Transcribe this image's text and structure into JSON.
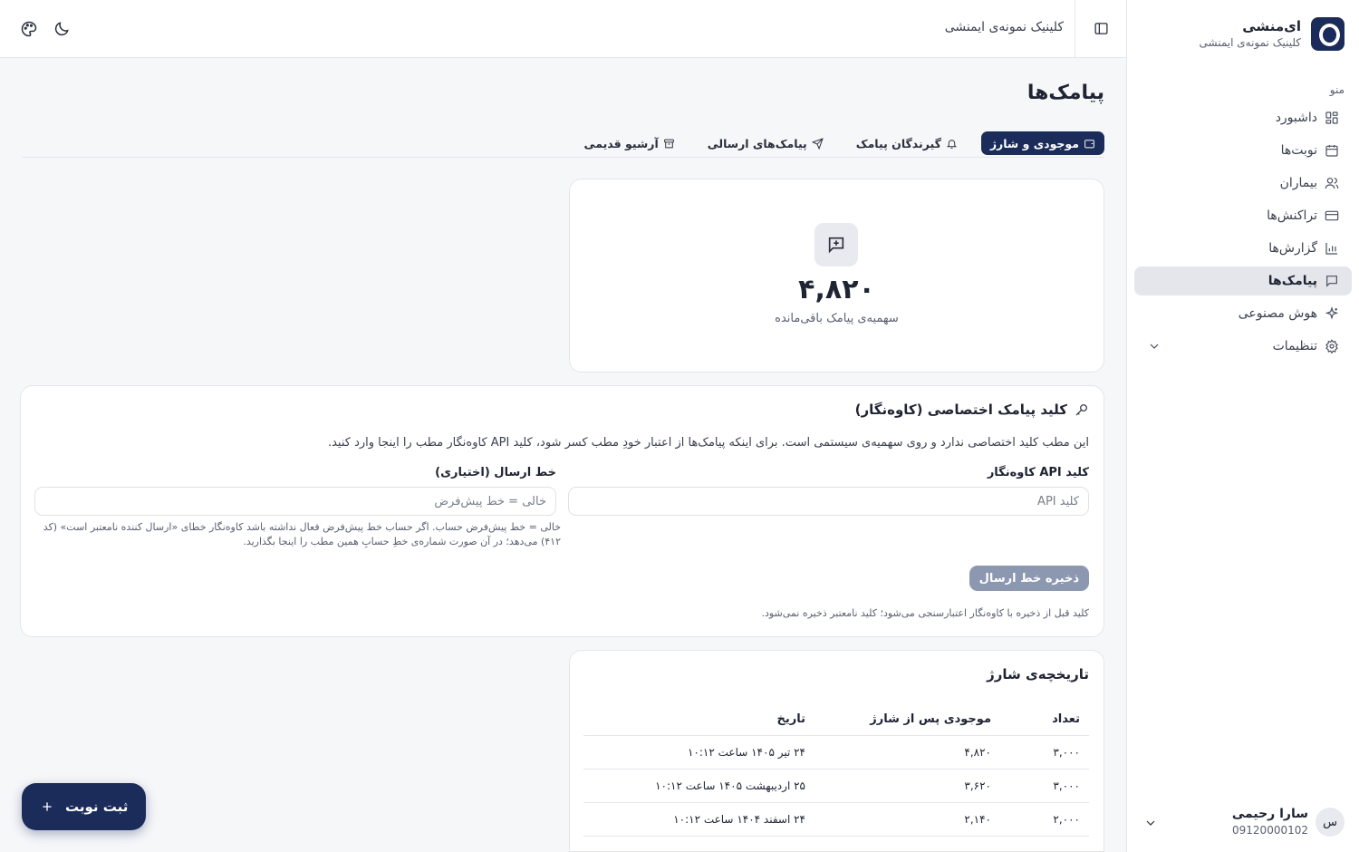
{
  "brand": {
    "name": "ای‌منشی",
    "clinic": "کلینیک نمونه‌ی ایمنشی"
  },
  "topbar": {
    "clinic_name": "کلینیک نمونه‌ی ایمنشی"
  },
  "sidebar": {
    "menu_label": "منو",
    "items": [
      {
        "label": "داشبورد",
        "icon": "dashboard-icon"
      },
      {
        "label": "نوبت‌ها",
        "icon": "calendar-icon"
      },
      {
        "label": "بیماران",
        "icon": "users-icon"
      },
      {
        "label": "تراکنش‌ها",
        "icon": "card-icon"
      },
      {
        "label": "گزارش‌ها",
        "icon": "chart-icon"
      },
      {
        "label": "پیامک‌ها",
        "icon": "message-icon",
        "active": true
      },
      {
        "label": "هوش مصنوعی",
        "icon": "sparkle-icon"
      },
      {
        "label": "تنظیمات",
        "icon": "gear-icon"
      }
    ]
  },
  "user": {
    "name": "سارا رحیمی",
    "phone": "09120000102",
    "initial": "س"
  },
  "page": {
    "title": "پیامک‌ها"
  },
  "tabs": [
    {
      "label": "موجودی و شارژ",
      "icon": "wallet-icon",
      "active": true
    },
    {
      "label": "گیرندگان پیامک",
      "icon": "bell-icon"
    },
    {
      "label": "پیامک‌های ارسالی",
      "icon": "send-icon"
    },
    {
      "label": "آرشیو قدیمی",
      "icon": "archive-icon"
    }
  ],
  "credit": {
    "value": "۴,۸۲۰",
    "label": "سهمیه‌ی پیامک باقی‌مانده"
  },
  "api_key": {
    "title": "کلید پیامک اختصاصی (کاوه‌نگار)",
    "description": "این مطب کلید اختصاصی ندارد و روی سهمیه‌ی سیستمی است. برای اینکه پیامک‌ها از اعتبار خودِ مطب کسر شود، کلید API کاوه‌نگار مطب را اینجا وارد کنید.",
    "key_label": "کلید API کاوه‌نگار",
    "key_placeholder": "کلید API",
    "line_label": "خط ارسال (اختیاری)",
    "line_placeholder": "خالی = خط پیش‌فرض",
    "line_hint": "خالی = خط پیش‌فرض حساب. اگر حساب خط پیش‌فرض فعال نداشته باشد کاوه‌نگار خطای «ارسال کننده نامعتبر است» (کد ۴۱۲) می‌دهد؛ در آن صورت شماره‌ی خطِ حسابِ همین مطب را اینجا بگذارید.",
    "save_label": "ذخیره خط ارسال",
    "note": "کلید قبل از ذخیره با کاوه‌نگار اعتبارسنجی می‌شود؛ کلید نامعتبر ذخیره نمی‌شود."
  },
  "history": {
    "title": "تاریخچه‌ی شارژ",
    "headers": [
      "تعداد",
      "موجودی پس از شارژ",
      "تاریخ"
    ],
    "rows": [
      [
        "۳,۰۰۰",
        "۴,۸۲۰",
        "۲۴ تیر ۱۴۰۵ ساعت ۱۰:۱۲"
      ],
      [
        "۳,۰۰۰",
        "۳,۶۲۰",
        "۲۵ اردیبهشت ۱۴۰۵ ساعت ۱۰:۱۲"
      ],
      [
        "۲,۰۰۰",
        "۲,۱۴۰",
        "۲۴ اسفند ۱۴۰۴ ساعت ۱۰:۱۲"
      ]
    ]
  },
  "fab": {
    "label": "ثبت نوبت"
  },
  "colors": {
    "primary": "#1b2c5b",
    "disabled_button": "#8c97b0",
    "active_menu_bg": "#e4e6ec"
  }
}
